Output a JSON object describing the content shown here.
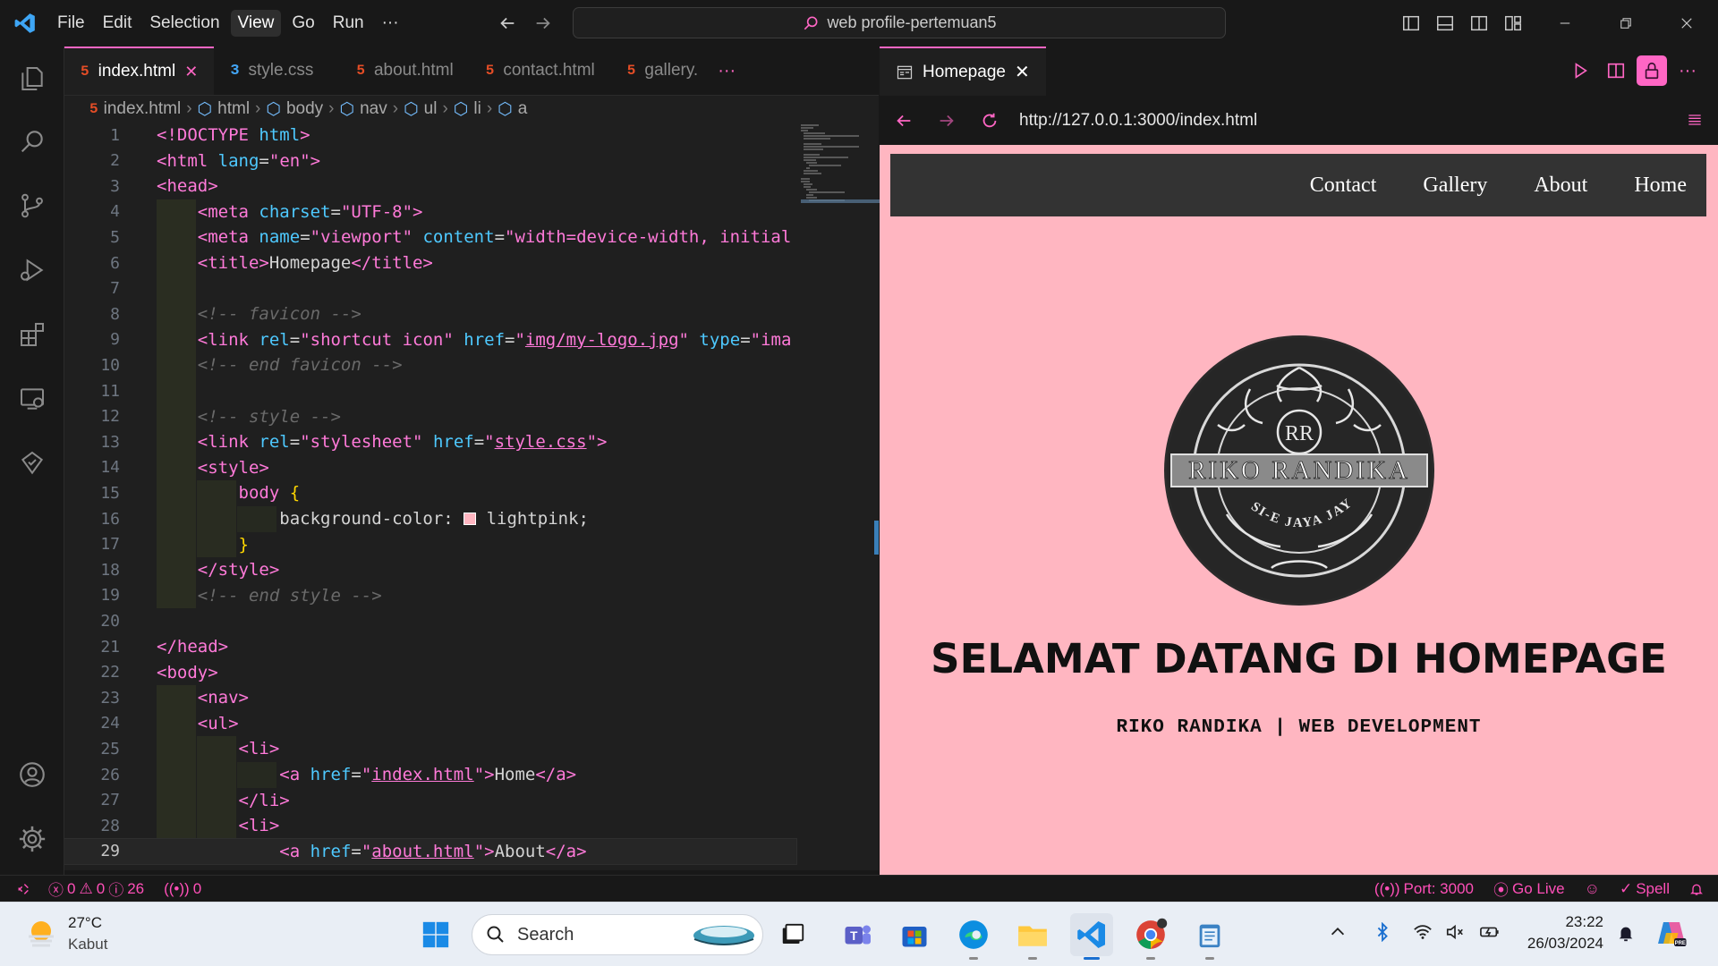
{
  "menu": [
    "File",
    "Edit",
    "Selection",
    "View",
    "Go",
    "Run",
    "···"
  ],
  "menu_active": "View",
  "command_center": {
    "text": "web profile-pertemuan5"
  },
  "editor_tabs": [
    {
      "label": "index.html",
      "icon": "html",
      "active": true
    },
    {
      "label": "style.css",
      "icon": "css",
      "active": false
    },
    {
      "label": "about.html",
      "icon": "html",
      "active": false
    },
    {
      "label": "contact.html",
      "icon": "html",
      "active": false
    },
    {
      "label": "gallery.",
      "icon": "html",
      "active": false
    }
  ],
  "breadcrumbs": [
    "index.html",
    "html",
    "body",
    "nav",
    "ul",
    "li",
    "a"
  ],
  "code_lines": [
    {
      "n": "1",
      "h": "<span class='tg'>&lt;!DOCTYPE</span> <span class='at'>html</span><span class='tg'>&gt;</span>"
    },
    {
      "n": "2",
      "h": "<span class='tg'>&lt;html</span> <span class='at'>lang</span>=<span class='st'>\"en\"</span><span class='tg'>&gt;</span>"
    },
    {
      "n": "3",
      "h": "<span class='tg'>&lt;head&gt;</span>"
    },
    {
      "n": "4",
      "h": "    <span class='tg'>&lt;meta</span> <span class='at'>charset</span>=<span class='st'>\"UTF-8\"</span><span class='tg'>&gt;</span>"
    },
    {
      "n": "5",
      "h": "    <span class='tg'>&lt;meta</span> <span class='at'>name</span>=<span class='st'>\"viewport\"</span> <span class='at'>content</span>=<span class='st'>\"width=device-width, initial</span>"
    },
    {
      "n": "6",
      "h": "    <span class='tg'>&lt;title&gt;</span>Homepage<span class='tg'>&lt;/title&gt;</span>"
    },
    {
      "n": "7",
      "h": ""
    },
    {
      "n": "8",
      "h": "    <span class='cm'>&lt;!-- favicon --&gt;</span>"
    },
    {
      "n": "9",
      "h": "    <span class='tg'>&lt;link</span> <span class='at'>rel</span>=<span class='st'>\"shortcut icon\"</span> <span class='at'>href</span>=<span class='st'>\"<span class='ul'>img/my-logo.jpg</span>\"</span> <span class='at'>type</span>=<span class='st'>\"ima</span>"
    },
    {
      "n": "10",
      "h": "    <span class='cm'>&lt;!-- end favicon --&gt;</span>"
    },
    {
      "n": "11",
      "h": ""
    },
    {
      "n": "12",
      "h": "    <span class='cm'>&lt;!-- style --&gt;</span>"
    },
    {
      "n": "13",
      "h": "    <span class='tg'>&lt;link</span> <span class='at'>rel</span>=<span class='st'>\"stylesheet\"</span> <span class='at'>href</span>=<span class='st'>\"<span class='ul'>style.css</span>\"</span><span class='tg'>&gt;</span>"
    },
    {
      "n": "14",
      "h": "    <span class='tg'>&lt;style&gt;</span>"
    },
    {
      "n": "15",
      "h": "        <span class='tg'>body</span> <span class='br'>{</span>"
    },
    {
      "n": "16",
      "h": "            background-color: <span style='display:inline-block;width:14px;height:14px;background:#ffb6c1;border:1px solid #fff;vertical-align:-1px'></span> lightpink;"
    },
    {
      "n": "17",
      "h": "        <span class='br'>}</span>"
    },
    {
      "n": "18",
      "h": "    <span class='tg'>&lt;/style&gt;</span>"
    },
    {
      "n": "19",
      "h": "    <span class='cm'>&lt;!-- end style --&gt;</span>"
    },
    {
      "n": "20",
      "h": ""
    },
    {
      "n": "21",
      "h": "<span class='tg'>&lt;/head&gt;</span>"
    },
    {
      "n": "22",
      "h": "<span class='tg'>&lt;body&gt;</span>"
    },
    {
      "n": "23",
      "h": "    <span class='tg'>&lt;nav&gt;</span>"
    },
    {
      "n": "24",
      "h": "    <span class='tg'>&lt;ul&gt;</span>"
    },
    {
      "n": "25",
      "h": "        <span class='tg'>&lt;li&gt;</span>"
    },
    {
      "n": "26",
      "h": "            <span class='tg'>&lt;a</span> <span class='at'>href</span>=<span class='st'>\"<span class='ul'>index.html</span>\"</span><span class='tg'>&gt;</span>Home<span class='tg'>&lt;/a&gt;</span>"
    },
    {
      "n": "27",
      "h": "        <span class='tg'>&lt;/li&gt;</span>"
    },
    {
      "n": "28",
      "h": "        <span class='tg'>&lt;li&gt;</span>"
    },
    {
      "n": "29",
      "h": "            <span class='tg'>&lt;a</span> <span class='at'>href</span>=<span class='st'>\"<span class='ul'>about.html</span>\"</span><span class='tg'>&gt;</span>About<span class='tg'>&lt;/a&gt;</span>"
    }
  ],
  "current_line": "29",
  "preview": {
    "tab_label": "Homepage",
    "url": "http://127.0.0.1:3000/index.html",
    "nav_links": [
      "Contact",
      "Gallery",
      "About",
      "Home"
    ],
    "logo_text": "RIKO RANDIKA",
    "logo_monogram": "RR",
    "logo_ribbon": "SI-E JAYA JAYA",
    "heading": "SELAMAT DATANG DI HOMEPAGE",
    "subheading": "RIKO RANDIKA | WEB DEVELOPMENT",
    "background": "#ffb6c1"
  },
  "status": {
    "errors": "0",
    "warnings": "0",
    "info": "26",
    "ports": "0",
    "port_label": "Port: 3000",
    "golive": "Go Live",
    "spell": "Spell",
    "accent": "#ff4fb8"
  },
  "taskbar": {
    "weather_temp": "27°C",
    "weather_desc": "Kabut",
    "search_placeholder": "Search",
    "time": "23:22",
    "date": "26/03/2024"
  },
  "colors": {
    "editor_bg": "#1f1f1f",
    "accent": "#ff66c4",
    "nav_bg": "#333333"
  }
}
